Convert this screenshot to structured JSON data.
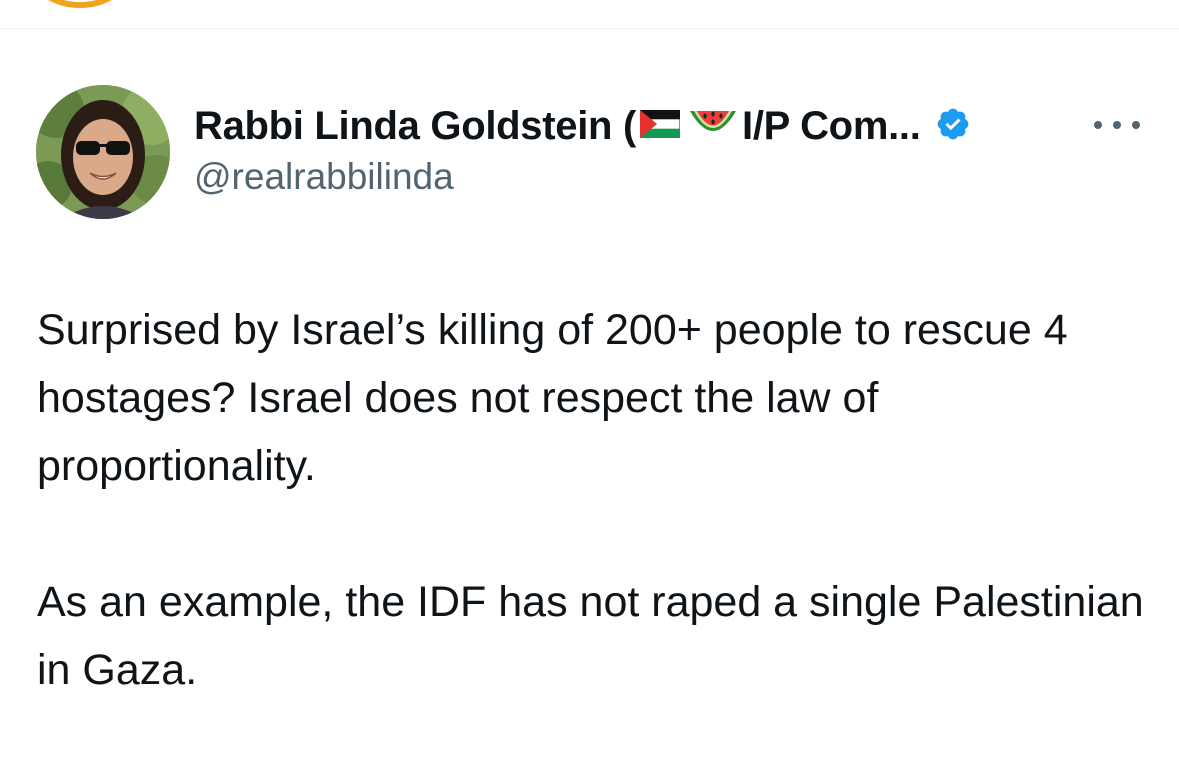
{
  "tweet": {
    "author": {
      "name_prefix": "Rabbi Linda Goldstein (",
      "name_suffix": "I/P Com...",
      "handle": "@realrabbilinda",
      "emojis": [
        "palestinian-flag",
        "watermelon"
      ],
      "verified": true
    },
    "body": {
      "paragraph_1": "Surprised by Israel’s killing of 200+ people to rescue 4 hostages? Israel does not respect the law of proportionality.",
      "paragraph_2": "As an example, the IDF has not raped a single Palestinian in Gaza."
    }
  },
  "colors": {
    "accent_verified": "#1d9bf0",
    "text_primary": "#0f1419",
    "text_secondary": "#536471",
    "top_arc": "#f2a41e"
  }
}
